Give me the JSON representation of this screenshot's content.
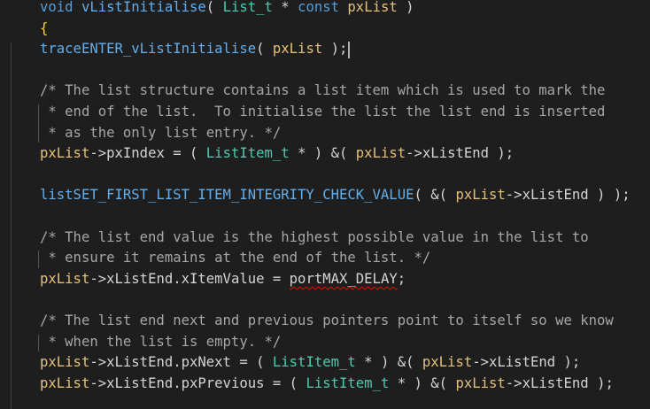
{
  "editor": {
    "lines": [
      {
        "tokens": [
          {
            "t": "void",
            "c": "kw"
          },
          {
            "t": " ",
            "c": "tx"
          },
          {
            "t": "vListInitialise",
            "c": "fn"
          },
          {
            "t": "( ",
            "c": "tx"
          },
          {
            "t": "List_t",
            "c": "ty"
          },
          {
            "t": " * ",
            "c": "tx"
          },
          {
            "t": "const",
            "c": "kw"
          },
          {
            "t": " ",
            "c": "tx"
          },
          {
            "t": "pxList",
            "c": "va"
          },
          {
            "t": " )",
            "c": "tx"
          }
        ]
      },
      {
        "tokens": [
          {
            "t": "{",
            "c": "br"
          }
        ]
      },
      {
        "tokens": [
          {
            "t": "traceENTER_vListInitialise",
            "c": "fn"
          },
          {
            "t": "( ",
            "c": "tx"
          },
          {
            "t": "pxList",
            "c": "va"
          },
          {
            "t": " );",
            "c": "tx"
          }
        ]
      },
      {
        "tokens": []
      },
      {
        "tokens": [
          {
            "t": "/* The list structure contains a list item which is used to mark the",
            "c": "cm"
          }
        ]
      },
      {
        "tokens": [
          {
            "t": " * end of the list.  To initialise the list the list end is inserted",
            "c": "cm"
          }
        ]
      },
      {
        "tokens": [
          {
            "t": " * as the only list entry. */",
            "c": "cm"
          }
        ]
      },
      {
        "tokens": [
          {
            "t": "pxList",
            "c": "va"
          },
          {
            "t": "->",
            "c": "tx"
          },
          {
            "t": "pxIndex",
            "c": "tx"
          },
          {
            "t": " = ( ",
            "c": "tx"
          },
          {
            "t": "ListItem_t",
            "c": "ty"
          },
          {
            "t": " * ) &( ",
            "c": "tx"
          },
          {
            "t": "pxList",
            "c": "va"
          },
          {
            "t": "->",
            "c": "tx"
          },
          {
            "t": "xListEnd",
            "c": "tx"
          },
          {
            "t": " );",
            "c": "tx"
          }
        ]
      },
      {
        "tokens": []
      },
      {
        "tokens": [
          {
            "t": "listSET_FIRST_LIST_ITEM_INTEGRITY_CHECK_VALUE",
            "c": "fn"
          },
          {
            "t": "( &( ",
            "c": "tx"
          },
          {
            "t": "pxList",
            "c": "va"
          },
          {
            "t": "->",
            "c": "tx"
          },
          {
            "t": "xListEnd",
            "c": "tx"
          },
          {
            "t": " ) );",
            "c": "tx"
          }
        ]
      },
      {
        "tokens": []
      },
      {
        "tokens": [
          {
            "t": "/* The list end value is the highest possible value in the list to",
            "c": "cm"
          }
        ]
      },
      {
        "tokens": [
          {
            "t": " * ensure it remains at the end of the list. */",
            "c": "cm"
          }
        ]
      },
      {
        "tokens": [
          {
            "t": "pxList",
            "c": "va"
          },
          {
            "t": "->",
            "c": "tx"
          },
          {
            "t": "xListEnd.xItemValue = ",
            "c": "tx"
          },
          {
            "t": "portMAX_DELAY",
            "c": "tx",
            "sq": true
          },
          {
            "t": ";",
            "c": "tx"
          }
        ]
      },
      {
        "tokens": []
      },
      {
        "tokens": [
          {
            "t": "/* The list end next and previous pointers point to itself so we know",
            "c": "cm"
          }
        ]
      },
      {
        "tokens": [
          {
            "t": " * when the list is empty. */",
            "c": "cm"
          }
        ]
      },
      {
        "tokens": [
          {
            "t": "pxList",
            "c": "va"
          },
          {
            "t": "->",
            "c": "tx"
          },
          {
            "t": "xListEnd.pxNext = ( ",
            "c": "tx"
          },
          {
            "t": "ListItem_t",
            "c": "ty"
          },
          {
            "t": " * ) &( ",
            "c": "tx"
          },
          {
            "t": "pxList",
            "c": "va"
          },
          {
            "t": "->",
            "c": "tx"
          },
          {
            "t": "xListEnd",
            "c": "tx"
          },
          {
            "t": " );",
            "c": "tx"
          }
        ]
      },
      {
        "tokens": [
          {
            "t": "pxList",
            "c": "va"
          },
          {
            "t": "->",
            "c": "tx"
          },
          {
            "t": "xListEnd.pxPrevious = ( ",
            "c": "tx"
          },
          {
            "t": "ListItem_t",
            "c": "ty"
          },
          {
            "t": " * ) &( ",
            "c": "tx"
          },
          {
            "t": "pxList",
            "c": "va"
          },
          {
            "t": "->",
            "c": "tx"
          },
          {
            "t": "xListEnd",
            "c": "tx"
          },
          {
            "t": " );",
            "c": "tx"
          }
        ]
      }
    ]
  }
}
